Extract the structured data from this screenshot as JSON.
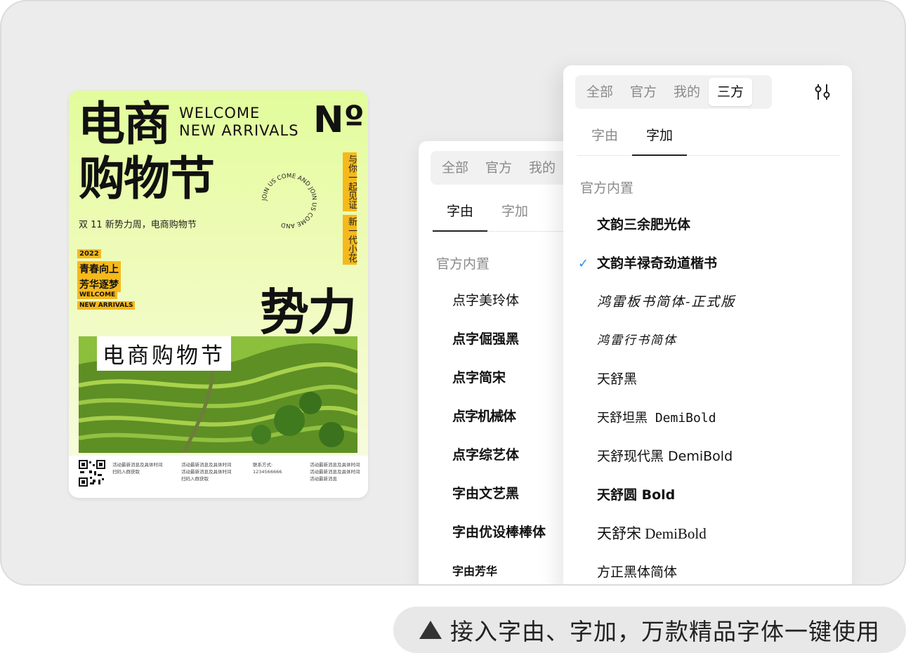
{
  "poster": {
    "title_line1": "电商",
    "title_line2": "购物节",
    "welcome_line1": "WELCOME",
    "welcome_line2": "NEW ARRIVALS",
    "numero": "Nº",
    "subcaption": "双 11 新势力周，电商购物节",
    "vtag1": "与你一起见证",
    "vtag2": "新一代小花",
    "ring_text": "JOIN US COME AND JOIN US COME AND ",
    "year": "2022",
    "tag1": "青春向上",
    "tag2": "芳华逐梦",
    "small_tag1": "WELCOME",
    "small_tag2": "NEW ARRIVALS",
    "big_word": "势力",
    "box_title": "电商购物节",
    "fine1": "活动最新消息及具体时间\n扫码入群获取",
    "fine2": "活动最新消息及具体时间\n活动最新消息及具体时间\n扫码入群获取",
    "fine3": "联系方式:\n1234566666",
    "fine4": "活动最新消息及具体时间\n活动最新消息及具体时间\n活动最新消息"
  },
  "back_panel": {
    "tabs": [
      "全部",
      "官方",
      "我的"
    ],
    "subtabs": [
      "字由",
      "字加"
    ],
    "active_subtab": 0,
    "section": "官方内置",
    "fonts": [
      "点字美玲体",
      "点字倔强黑",
      "点字简宋",
      "点字机械体",
      "点字综艺体",
      "字由文艺黑",
      "字由优设棒棒体",
      "字由芳华"
    ]
  },
  "front_panel": {
    "tabs": [
      "全部",
      "官方",
      "我的",
      "三方"
    ],
    "active_tab": 3,
    "subtabs": [
      "字由",
      "字加"
    ],
    "active_subtab": 1,
    "section": "官方内置",
    "selected_index": 1,
    "fonts": [
      "文韵三余肥光体",
      "文韵羊禄奇劲道楷书",
      "鸿雷板书简体-正式版",
      "鸿雷行书简体",
      "天舒黑",
      "天舒坦黑 DemiBold",
      "天舒现代黑 DemiBold",
      "天舒圆 Bold",
      "天舒宋 DemiBold",
      "方正黑体简体"
    ],
    "filter_icon": "sliders-icon",
    "check_color": "#1e90ff"
  },
  "caption": "接入字由、字加，万款精品字体一键使用",
  "colors": {
    "accent_yellow": "#f6b91c",
    "poster_green": "#e2fc9c",
    "check_blue": "#1e90ff"
  }
}
